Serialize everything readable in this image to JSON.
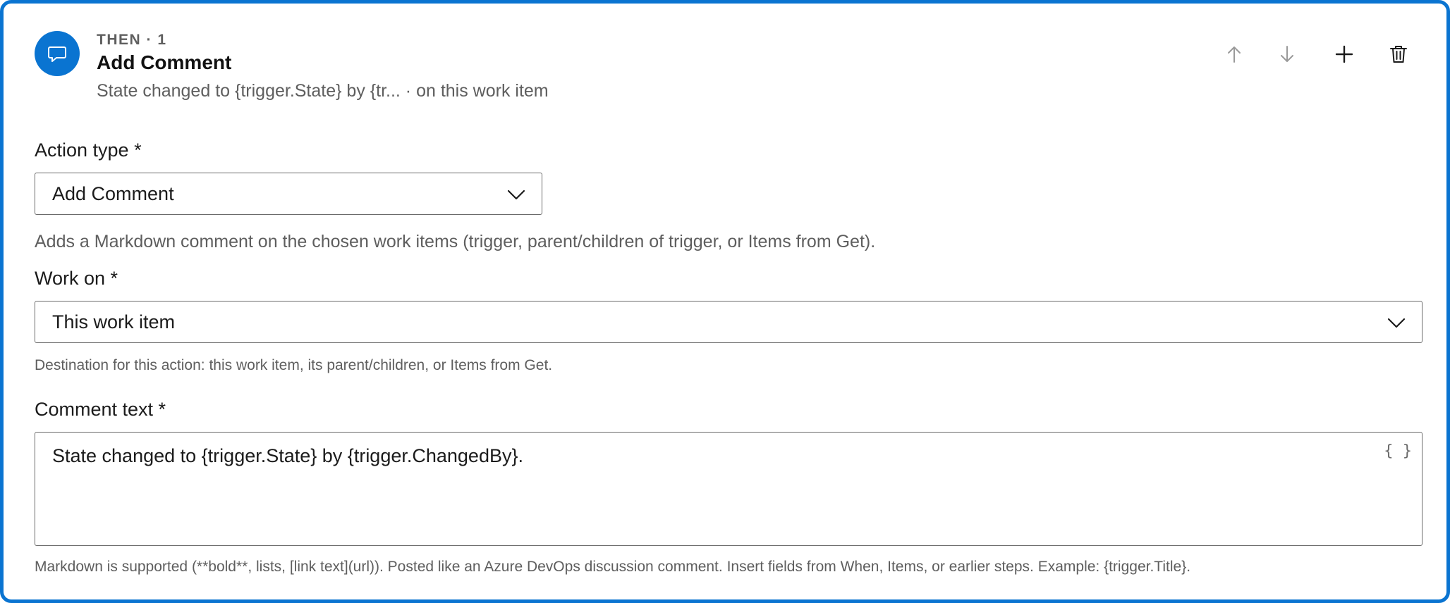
{
  "header": {
    "step_label": "THEN · 1",
    "title": "Add Comment",
    "summary": "State changed to {trigger.State} by {tr... · on this work item"
  },
  "toolbar": {
    "move_up_icon": "arrow-up-icon",
    "move_down_icon": "arrow-down-icon",
    "add_icon": "plus-icon",
    "delete_icon": "trash-icon"
  },
  "action_type": {
    "label": "Action type *",
    "value": "Add Comment",
    "help": "Adds a Markdown comment on the chosen work items (trigger, parent/children of trigger, or Items from Get)."
  },
  "work_on": {
    "label": "Work on *",
    "value": "This work item",
    "help": "Destination for this action: this work item, its parent/children, or Items from Get."
  },
  "comment": {
    "label": "Comment text *",
    "value": "State changed to {trigger.State} by {trigger.ChangedBy}.",
    "insert_field_glyph": "{ }",
    "help": "Markdown is supported (**bold**, lists, [link text](url)). Posted like an Azure DevOps discussion comment. Insert fields from When, Items, or earlier steps. Example: {trigger.Title}."
  },
  "colors": {
    "accent": "#0a74d1",
    "muted_text": "#5e5e5e",
    "border": "#6b6b6b"
  }
}
